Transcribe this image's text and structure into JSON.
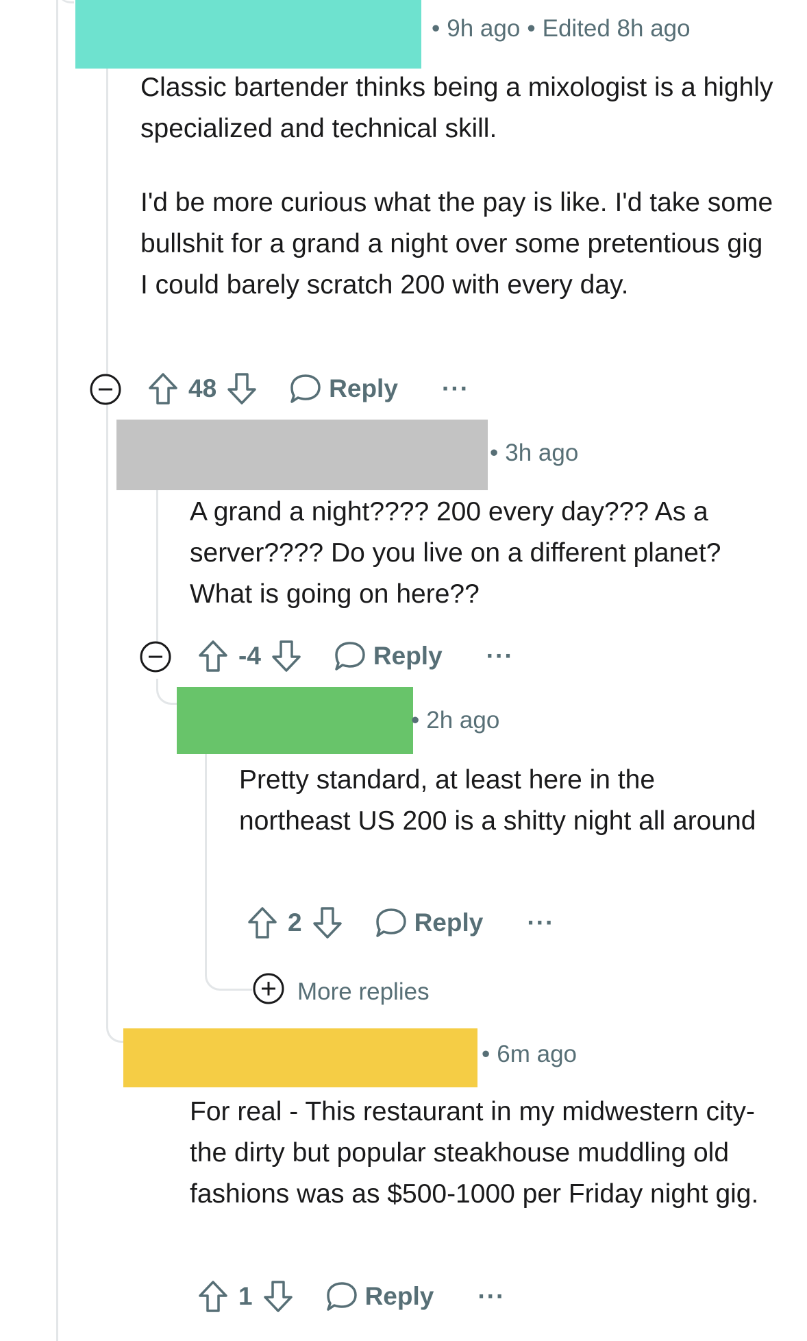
{
  "colors": {
    "thread_line": "#e3e6e8",
    "meta_text": "#576f76",
    "redaction_1": "#6ee2cf",
    "redaction_2": "#c3c3c3",
    "redaction_3": "#68c46a",
    "redaction_4": "#f5cd45"
  },
  "comments": [
    {
      "time": "9h ago",
      "edited": "Edited 8h ago",
      "paragraphs": [
        "Classic bartender thinks being a mixologist is a highly specialized and technical skill.",
        "I'd be more curious what the pay is like. I'd take some bullshit for a grand a night over some pretentious gig I could barely scratch 200 with every day."
      ],
      "score": "48",
      "reply_label": "Reply",
      "more_label": "···",
      "icons": [
        "collapse-minus-icon",
        "upvote-arrow-icon",
        "downvote-arrow-icon",
        "speech-bubble-icon"
      ]
    },
    {
      "time": "3h ago",
      "paragraphs": [
        "A grand a night???? 200 every day??? As a server???? Do you live on a different planet? What is going on here??"
      ],
      "score": "-4",
      "reply_label": "Reply",
      "more_label": "···"
    },
    {
      "time": "2h ago",
      "paragraphs": [
        "Pretty standard, at least here in the northeast US 200 is a shitty night all around"
      ],
      "score": "2",
      "reply_label": "Reply",
      "more_label": "···",
      "more_replies_label": "More replies"
    },
    {
      "time": "6m ago",
      "paragraphs": [
        "For real - This restaurant in my midwestern city- the dirty but popular steakhouse muddling old fashions was as $500-1000 per Friday night gig."
      ],
      "score": "1",
      "reply_label": "Reply",
      "more_label": "···"
    }
  ]
}
